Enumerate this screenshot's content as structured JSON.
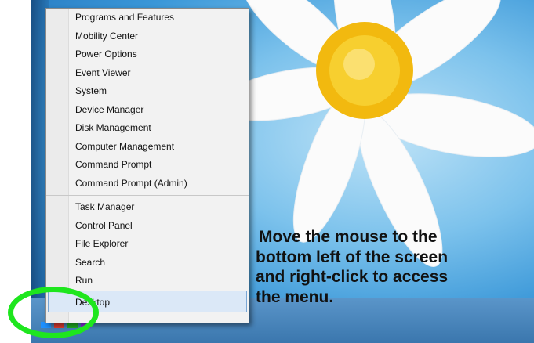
{
  "context_menu": {
    "items": [
      {
        "label": "Programs and Features"
      },
      {
        "label": "Mobility Center"
      },
      {
        "label": "Power Options"
      },
      {
        "label": "Event Viewer"
      },
      {
        "label": "System"
      },
      {
        "label": "Device Manager"
      },
      {
        "label": "Disk Management"
      },
      {
        "label": "Computer Management"
      },
      {
        "label": "Command Prompt"
      },
      {
        "label": "Command Prompt (Admin)"
      },
      {
        "label": "Task Manager"
      },
      {
        "label": "Control Panel"
      },
      {
        "label": "File Explorer"
      },
      {
        "label": "Search"
      },
      {
        "label": "Run"
      },
      {
        "label": "Desktop"
      }
    ],
    "highlighted_item": "Desktop"
  },
  "callout": {
    "line1": "Move the mouse to the",
    "line2": "bottom left of the screen",
    "line3": "and right-click to access",
    "line4": "the menu."
  },
  "icons": {
    "taskbar_app": "internet-explorer-icon",
    "start": "windows-start-icon"
  },
  "colors": {
    "highlight_ring": "#1ee61e",
    "menu_background": "#f2f2f2",
    "menu_highlight": "#dbe8f7",
    "taskbar": "#3a76ad"
  }
}
